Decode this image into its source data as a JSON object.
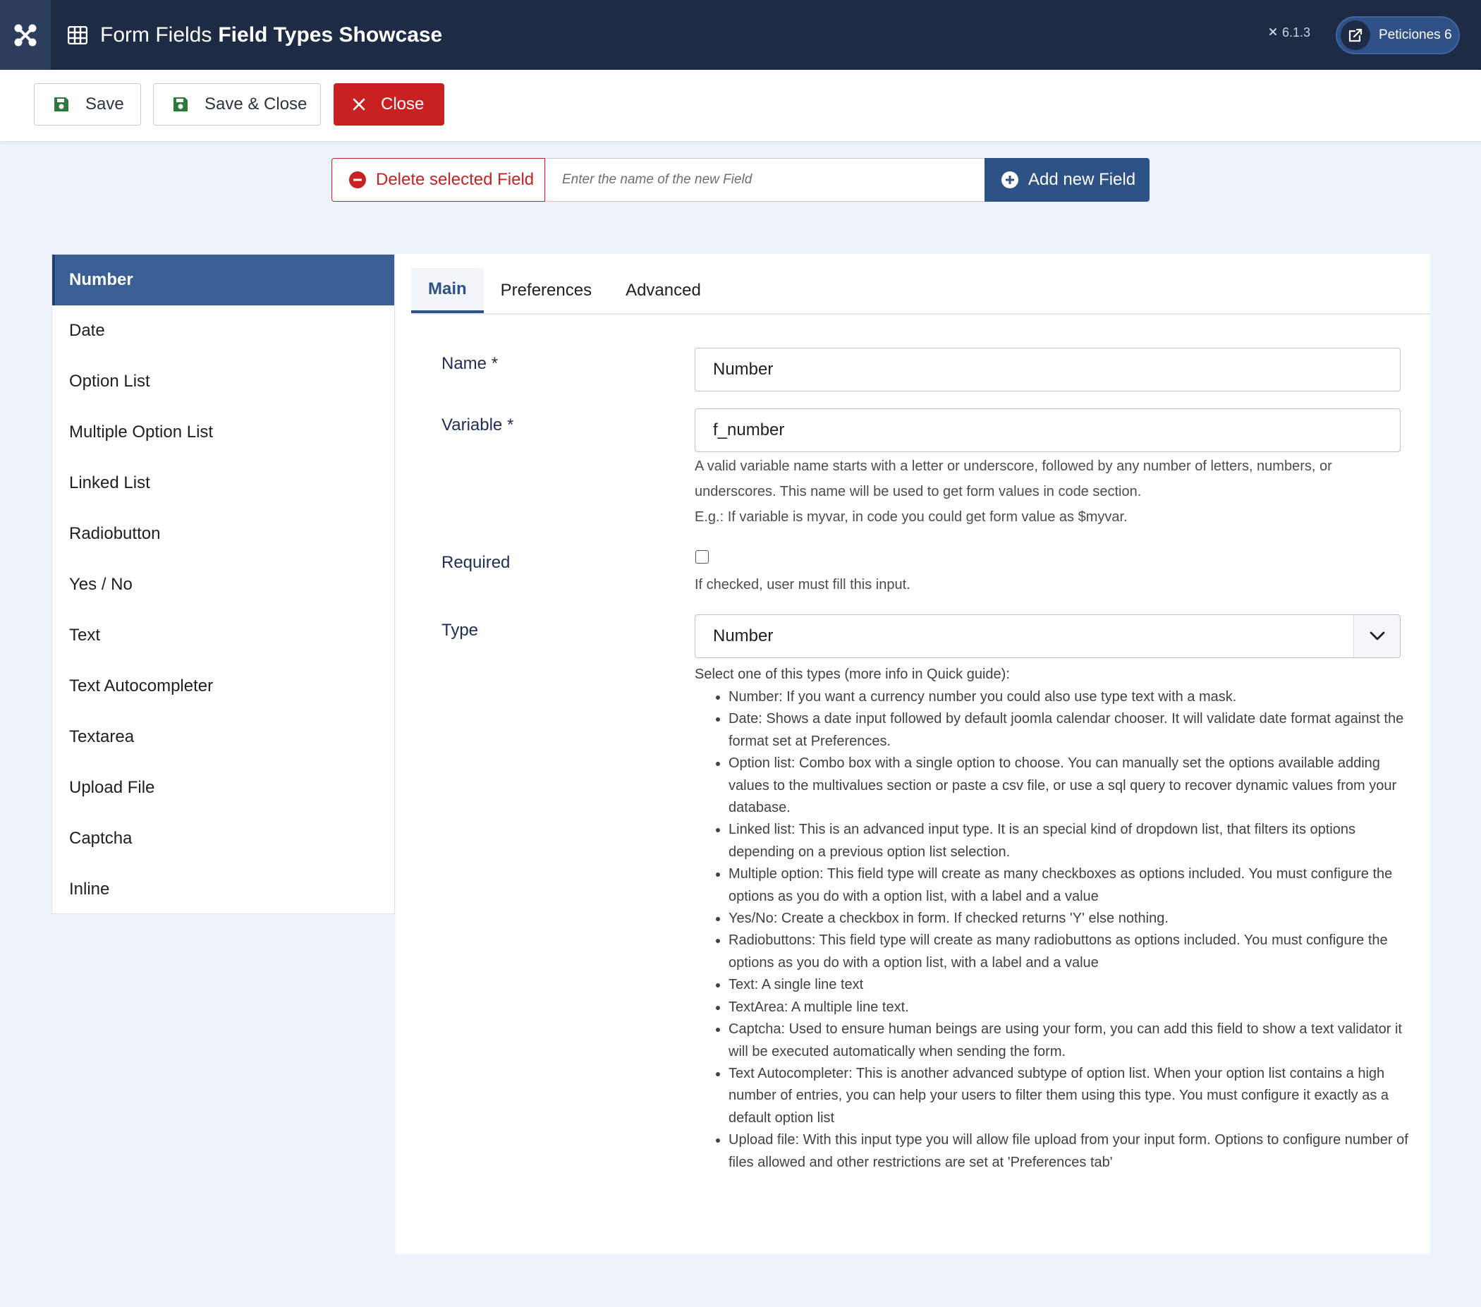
{
  "header": {
    "title_light": "Form Fields",
    "title_bold": "Field Types Showcase",
    "version": "6.1.3",
    "peticiones_label": "Peticiones 6"
  },
  "toolbar": {
    "save_label": "Save",
    "save_close_label": "Save & Close",
    "close_label": "Close"
  },
  "field_bar": {
    "delete_label": "Delete selected Field",
    "new_field_placeholder": "Enter the name of the new Field",
    "add_label": "Add new Field"
  },
  "sidebar": {
    "items": [
      {
        "label": "Number",
        "active": true
      },
      {
        "label": "Date"
      },
      {
        "label": "Option List"
      },
      {
        "label": "Multiple Option List"
      },
      {
        "label": "Linked List"
      },
      {
        "label": "Radiobutton"
      },
      {
        "label": "Yes / No"
      },
      {
        "label": "Text"
      },
      {
        "label": "Text Autocompleter"
      },
      {
        "label": "Textarea"
      },
      {
        "label": "Upload File"
      },
      {
        "label": "Captcha"
      },
      {
        "label": "Inline"
      }
    ]
  },
  "tabs": [
    {
      "label": "Main",
      "active": true
    },
    {
      "label": "Preferences"
    },
    {
      "label": "Advanced"
    }
  ],
  "form": {
    "name_label": "Name *",
    "name_value": "Number",
    "variable_label": "Variable *",
    "variable_value": "f_number",
    "variable_help_1": "A valid variable name starts with a letter or underscore, followed by any number of letters, numbers, or underscores. This name will be used to get form values in code section.",
    "variable_help_2": "E.g.: If variable is myvar, in code you could get form value as $myvar.",
    "required_label": "Required",
    "required_checked": false,
    "required_help": "If checked, user must fill this input.",
    "type_label": "Type",
    "type_value": "Number",
    "type_help_intro": "Select one of this types (more info in Quick guide):",
    "type_help_items": [
      "Number: If you want a currency number you could also use type text with a mask.",
      "Date: Shows a date input followed by default joomla calendar chooser. It will validate date format against the format set at Preferences.",
      "Option list: Combo box with a single option to choose. You can manually set the options available adding values to the multivalues section or paste a csv file, or use a sql query to recover dynamic values from your database.",
      "Linked list: This is an advanced input type. It is an special kind of dropdown list, that filters its options depending on a previous option list selection.",
      "Multiple option: This field type will create as many checkboxes as options included. You must configure the options as you do with a option list, with a label and a value",
      "Yes/No: Create a checkbox in form. If checked returns 'Y' else nothing.",
      "Radiobuttons: This field type will create as many radiobuttons as options included. You must configure the options as you do with a option list, with a label and a value",
      "Text: A single line text",
      "TextArea: A multiple line text.",
      "Captcha: Used to ensure human beings are using your form, you can add this field to show a text validator it will be executed automatically when sending the form.",
      "Text Autocompleter: This is another advanced subtype of option list. When your option list contains a high number of entries, you can help your users to filter them using this type. You must configure it exactly as a default option list",
      "Upload file: With this input type you will allow file upload from your input form. Options to configure number of files allowed and other restrictions are set at 'Preferences tab'"
    ]
  },
  "colors": {
    "header_bg": "#1d2b45",
    "primary": "#2d5286",
    "danger": "#c92121",
    "save_icon": "#2a7a3a"
  }
}
